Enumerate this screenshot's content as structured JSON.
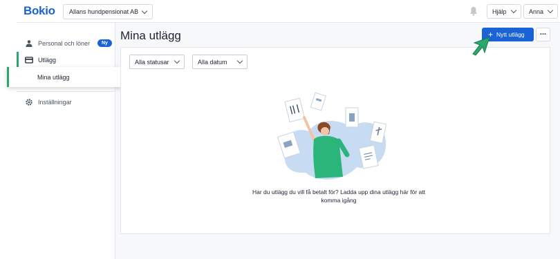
{
  "topbar": {
    "logo": "Bokio",
    "company": "Allans hundpensionat AB",
    "help_label": "Hjälp",
    "user_label": "Anna"
  },
  "sidebar": {
    "items": [
      {
        "label": "Personal och löner",
        "badge": "Ny"
      },
      {
        "label": "Utlägg"
      },
      {
        "label": "Mina utlägg"
      },
      {
        "label": "Inställningar"
      }
    ]
  },
  "main": {
    "title": "Mina utlägg",
    "new_button_label": "Nytt utlägg",
    "more_label": "...",
    "filters": [
      {
        "label": "Alla statusar"
      },
      {
        "label": "Alla datum"
      }
    ],
    "empty_message": "Har du utlägg du vill få betalt för? Ladda upp dina utlägg här för att komma igång"
  },
  "colors": {
    "brand": "#1a63d6",
    "accent_green": "#2aa76b"
  }
}
